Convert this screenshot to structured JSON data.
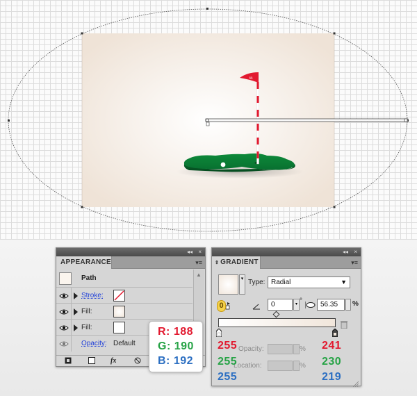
{
  "flag_number": "11",
  "appearance_panel": {
    "tab_label": "APPEARANCE",
    "collapse_glyph": "◂◂",
    "close_glyph": "×",
    "menu_glyph": "▾≡",
    "title_row": {
      "label": "Path",
      "thumbnail_icon": "path-thumbnail-icon"
    },
    "rows": [
      {
        "label": "Stroke:",
        "swatch": "none-swatch",
        "visible": true
      },
      {
        "label": "Fill:",
        "swatch": "gradient-swatch",
        "visible": true
      },
      {
        "label": "Fill:",
        "swatch": "white-swatch",
        "visible": true
      },
      {
        "label": "Opacity:",
        "value": "Default",
        "visible": true
      }
    ],
    "footer_icons": [
      "add-new-stroke-icon",
      "add-new-fill-icon",
      "add-effect-icon",
      "clear-appearance-icon"
    ],
    "fx_glyph": "fx"
  },
  "gradient_panel": {
    "tab_label": "GRADIENT",
    "collapse_glyph": "◂◂",
    "close_glyph": "×",
    "menu_glyph": "▾≡",
    "type_label": "Type:",
    "type_value": "Radial",
    "angle_value": "0",
    "degree_symbol": "°",
    "aspect_value": "56.35",
    "percent": "%",
    "opacity_label": "Opacity:",
    "location_label": "Location:",
    "badge": "0",
    "stop_colors": {
      "left": "#ffffff",
      "right": "#f1e6db"
    }
  },
  "rgb_overlay": {
    "callout": {
      "r": "R: 188",
      "g": "G: 190",
      "b": "B: 192"
    },
    "left_stop": {
      "r": "255",
      "g": "255",
      "b": "255"
    },
    "right_stop": {
      "r": "241",
      "g": "230",
      "b": "219"
    }
  },
  "colors": {
    "red": "#e2192f",
    "green": "#27a346",
    "blue": "#2c6fc2",
    "artboard_center": "#ffffff",
    "artboard_edge": "#efe3d7",
    "putting_green": "#0a7a32",
    "flag_red": "#e2192f"
  }
}
